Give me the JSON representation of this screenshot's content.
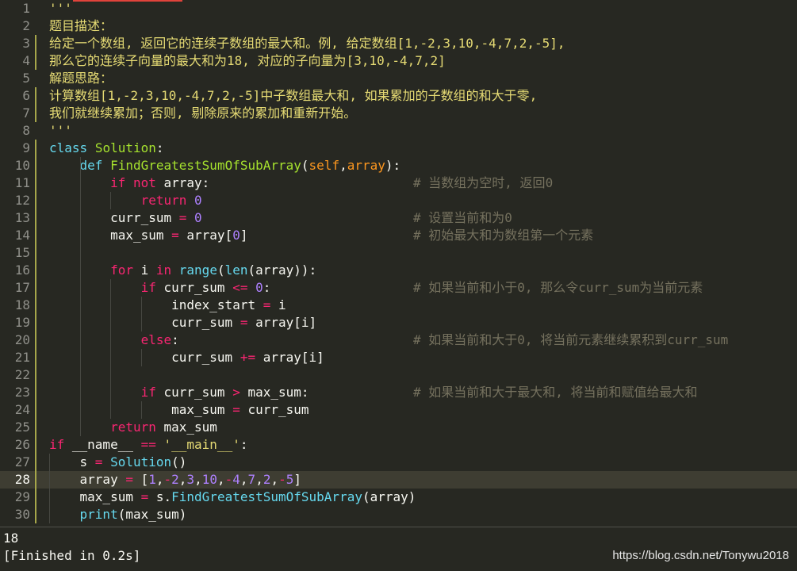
{
  "editor": {
    "language": "python",
    "active_line": 28,
    "modified_lines": [
      3,
      4,
      6,
      7,
      9,
      10,
      11,
      12,
      13,
      14,
      15,
      16,
      17,
      18,
      19,
      20,
      21,
      22,
      23,
      24,
      25,
      26,
      27,
      28,
      29,
      30
    ],
    "lines": [
      {
        "n": "1",
        "code": [
          [
            "s",
            "'''"
          ]
        ]
      },
      {
        "n": "2",
        "code": [
          [
            "s",
            "题目描述："
          ]
        ]
      },
      {
        "n": "3",
        "code": [
          [
            "s",
            "给定一个数组, 返回它的连续子数组的最大和。例, 给定数组[1,-2,3,10,-4,7,2,-5],"
          ]
        ]
      },
      {
        "n": "4",
        "code": [
          [
            "s",
            "那么它的连续子向量的最大和为18, 对应的子向量为[3,10,-4,7,2]"
          ]
        ]
      },
      {
        "n": "5",
        "code": [
          [
            "s",
            "解题思路："
          ]
        ]
      },
      {
        "n": "6",
        "code": [
          [
            "s",
            "计算数组[1,-2,3,10,-4,7,2,-5]中子数组最大和, 如果累加的子数组的和大于零,"
          ]
        ]
      },
      {
        "n": "7",
        "code": [
          [
            "s",
            "我们就继续累加；否则, 剔除原来的累加和重新开始。"
          ]
        ]
      },
      {
        "n": "8",
        "code": [
          [
            "s",
            "'''"
          ]
        ]
      },
      {
        "n": "9",
        "code": [
          [
            "sc",
            "class"
          ],
          [
            "p",
            " "
          ],
          [
            "cl",
            "Solution"
          ],
          [
            "p",
            ":"
          ]
        ]
      },
      {
        "n": "10",
        "code": [
          [
            "p",
            "    "
          ],
          [
            "sc",
            "def"
          ],
          [
            "p",
            " "
          ],
          [
            "fn",
            "FindGreatestSumOfSubArray"
          ],
          [
            "p",
            "("
          ],
          [
            "pa",
            "self"
          ],
          [
            "p",
            ","
          ],
          [
            "pa",
            "array"
          ],
          [
            "p",
            "):"
          ]
        ]
      },
      {
        "n": "11",
        "code": [
          [
            "p",
            "        "
          ],
          [
            "kw",
            "if"
          ],
          [
            "p",
            " "
          ],
          [
            "kw",
            "not"
          ],
          [
            "p",
            " array:"
          ]
        ],
        "comment": "# 当数组为空时, 返回0"
      },
      {
        "n": "12",
        "code": [
          [
            "p",
            "            "
          ],
          [
            "kw",
            "return"
          ],
          [
            "p",
            " "
          ],
          [
            "num",
            "0"
          ]
        ]
      },
      {
        "n": "13",
        "code": [
          [
            "p",
            "        curr_sum "
          ],
          [
            "kw",
            "="
          ],
          [
            "p",
            " "
          ],
          [
            "num",
            "0"
          ]
        ],
        "comment": "# 设置当前和为0"
      },
      {
        "n": "14",
        "code": [
          [
            "p",
            "        max_sum "
          ],
          [
            "kw",
            "="
          ],
          [
            "p",
            " array["
          ],
          [
            "num",
            "0"
          ],
          [
            "p",
            "]"
          ]
        ],
        "comment": "# 初始最大和为数组第一个元素"
      },
      {
        "n": "15",
        "code": []
      },
      {
        "n": "16",
        "code": [
          [
            "p",
            "        "
          ],
          [
            "kw",
            "for"
          ],
          [
            "p",
            " i "
          ],
          [
            "kw",
            "in"
          ],
          [
            "p",
            " "
          ],
          [
            "bi",
            "range"
          ],
          [
            "p",
            "("
          ],
          [
            "bi",
            "len"
          ],
          [
            "p",
            "(array)):"
          ]
        ]
      },
      {
        "n": "17",
        "code": [
          [
            "p",
            "            "
          ],
          [
            "kw",
            "if"
          ],
          [
            "p",
            " curr_sum "
          ],
          [
            "kw",
            "<="
          ],
          [
            "p",
            " "
          ],
          [
            "num",
            "0"
          ],
          [
            "p",
            ":"
          ]
        ],
        "comment": "# 如果当前和小于0, 那么令curr_sum为当前元素"
      },
      {
        "n": "18",
        "code": [
          [
            "p",
            "                index_start "
          ],
          [
            "kw",
            "="
          ],
          [
            "p",
            " i"
          ]
        ]
      },
      {
        "n": "19",
        "code": [
          [
            "p",
            "                curr_sum "
          ],
          [
            "kw",
            "="
          ],
          [
            "p",
            " array[i]"
          ]
        ]
      },
      {
        "n": "20",
        "code": [
          [
            "p",
            "            "
          ],
          [
            "kw",
            "else"
          ],
          [
            "p",
            ":"
          ]
        ],
        "comment": "# 如果当前和大于0, 将当前元素继续累积到curr_sum"
      },
      {
        "n": "21",
        "code": [
          [
            "p",
            "                curr_sum "
          ],
          [
            "kw",
            "+="
          ],
          [
            "p",
            " array[i]"
          ]
        ]
      },
      {
        "n": "22",
        "code": []
      },
      {
        "n": "23",
        "code": [
          [
            "p",
            "            "
          ],
          [
            "kw",
            "if"
          ],
          [
            "p",
            " curr_sum "
          ],
          [
            "kw",
            ">"
          ],
          [
            "p",
            " max_sum:"
          ]
        ],
        "comment": "# 如果当前和大于最大和, 将当前和赋值给最大和"
      },
      {
        "n": "24",
        "code": [
          [
            "p",
            "                max_sum "
          ],
          [
            "kw",
            "="
          ],
          [
            "p",
            " curr_sum"
          ]
        ]
      },
      {
        "n": "25",
        "code": [
          [
            "p",
            "        "
          ],
          [
            "kw",
            "return"
          ],
          [
            "p",
            " max_sum"
          ]
        ]
      },
      {
        "n": "26",
        "code": [
          [
            "kw",
            "if"
          ],
          [
            "p",
            " __name__ "
          ],
          [
            "kw",
            "=="
          ],
          [
            "p",
            " "
          ],
          [
            "s",
            "'__main__'"
          ],
          [
            "p",
            ":"
          ]
        ]
      },
      {
        "n": "27",
        "code": [
          [
            "p",
            "    s "
          ],
          [
            "kw",
            "="
          ],
          [
            "p",
            " "
          ],
          [
            "bi",
            "Solution"
          ],
          [
            "p",
            "()"
          ]
        ]
      },
      {
        "n": "28",
        "code": [
          [
            "p",
            "    array "
          ],
          [
            "kw",
            "="
          ],
          [
            "p",
            " ["
          ],
          [
            "num",
            "1"
          ],
          [
            "p",
            ","
          ],
          [
            "kw",
            "-"
          ],
          [
            "num",
            "2"
          ],
          [
            "p",
            ","
          ],
          [
            "num",
            "3"
          ],
          [
            "p",
            ","
          ],
          [
            "num",
            "10"
          ],
          [
            "p",
            ","
          ],
          [
            "kw",
            "-"
          ],
          [
            "num",
            "4"
          ],
          [
            "p",
            ","
          ],
          [
            "num",
            "7"
          ],
          [
            "p",
            ","
          ],
          [
            "num",
            "2"
          ],
          [
            "p",
            ","
          ],
          [
            "kw",
            "-"
          ],
          [
            "num",
            "5"
          ],
          [
            "p",
            "]"
          ]
        ]
      },
      {
        "n": "29",
        "code": [
          [
            "p",
            "    max_sum "
          ],
          [
            "kw",
            "="
          ],
          [
            "p",
            " s."
          ],
          [
            "bi",
            "FindGreatestSumOfSubArray"
          ],
          [
            "p",
            "(array)"
          ]
        ]
      },
      {
        "n": "30",
        "code": [
          [
            "p",
            "    "
          ],
          [
            "bi",
            "print"
          ],
          [
            "p",
            "(max_sum)"
          ]
        ]
      }
    ]
  },
  "syntax_colors": {
    "p": "#f8f8f2",
    "s": "#e6db74",
    "kw": "#f92672",
    "sc": "#66d9ef",
    "cl": "#a6e22e",
    "fn": "#a6e22e",
    "pa": "#fd971f",
    "num": "#ae81ff",
    "bi": "#66d9ef",
    "cmt": "#75715e"
  },
  "output": {
    "result": "18",
    "status": "[Finished in 0.2s]"
  },
  "watermark": "https://blog.csdn.net/Tonywu2018"
}
